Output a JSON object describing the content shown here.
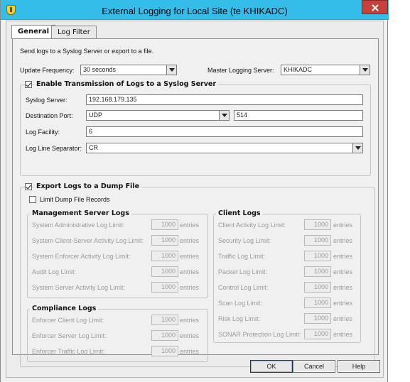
{
  "window": {
    "title": "External Logging for Local Site (te KHIKADC)"
  },
  "tabs": [
    {
      "label": "General"
    },
    {
      "label": "Log Filter"
    }
  ],
  "general": {
    "intro": "Send logs to a Syslog Server or export to a file.",
    "update_frequency": {
      "label": "Update Frequency:",
      "value": "30 seconds"
    },
    "master_logging_server": {
      "label": "Master Logging Server:",
      "value": "KHIKADC"
    },
    "syslog": {
      "title": "Enable Transmission of Logs to a Syslog Server",
      "checked": true,
      "server_label": "Syslog Server:",
      "server_value": "192.168.179.135",
      "port_label": "Destination Port:",
      "protocol_value": "UDP",
      "port_value": "514",
      "facility_label": "Log Facility:",
      "facility_value": "6",
      "separator_label": "Log Line Separator:",
      "separator_value": "CR"
    },
    "dump": {
      "title": "Export Logs to a Dump File",
      "checked": true,
      "limit_label": "Limit Dump File Records",
      "limit_checked": false,
      "unit": "entries",
      "management": {
        "title": "Management Server Logs",
        "rows": [
          {
            "label": "System Administrative Log Limit:",
            "value": "1000"
          },
          {
            "label": "System Client-Server Activity Log Limit:",
            "value": "1000"
          },
          {
            "label": "System Enforcer Activity Log Limit:",
            "value": "1000"
          },
          {
            "label": "Audit Log Limit:",
            "value": "1000"
          },
          {
            "label": "System Server Activity Log Limit:",
            "value": "1000"
          }
        ]
      },
      "compliance": {
        "title": "Compliance Logs",
        "rows": [
          {
            "label": "Enforcer Client Log Limit:",
            "value": "1000"
          },
          {
            "label": "Enforcer Server Log Limit:",
            "value": "1000"
          },
          {
            "label": "Enforcer Traffic Log Limit:",
            "value": "1000"
          }
        ]
      },
      "client": {
        "title": "Client Logs",
        "rows": [
          {
            "label": "Client Activity Log Limit:",
            "value": "1000"
          },
          {
            "label": "Security Log Limit:",
            "value": "1000"
          },
          {
            "label": "Traffic Log Limit:",
            "value": "1000"
          },
          {
            "label": "Packet Log Limit:",
            "value": "1000"
          },
          {
            "label": "Control Log Limit:",
            "value": "1000"
          },
          {
            "label": "Scan Log Limit:",
            "value": "1000"
          },
          {
            "label": "Risk Log Limit:",
            "value": "1000"
          },
          {
            "label": "SONAR Protection Log Limit:",
            "value": "1000"
          }
        ]
      }
    }
  },
  "buttons": {
    "ok": "OK",
    "cancel": "Cancel",
    "help": "Help"
  },
  "colors": {
    "titlebar": "#33bde8",
    "close": "#c7403a"
  }
}
